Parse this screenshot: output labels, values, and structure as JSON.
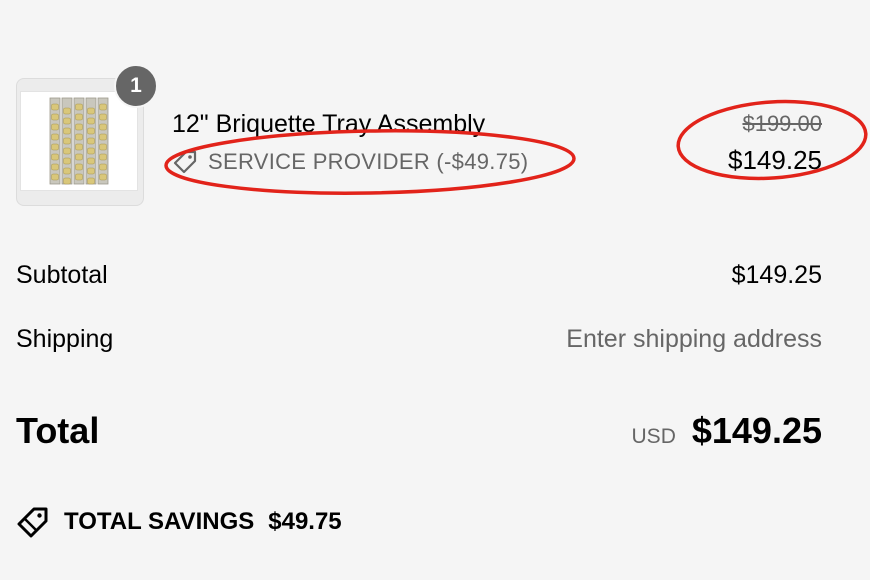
{
  "line_item": {
    "quantity": "1",
    "product_title": "12\" Briquette Tray Assembly",
    "discount_label": "SERVICE PROVIDER (-$49.75)",
    "original_price": "$199.00",
    "sale_price": "$149.25",
    "image_icon": "briquette-tray-product-image"
  },
  "summary": {
    "subtotal_label": "Subtotal",
    "subtotal_value": "$149.25",
    "shipping_label": "Shipping",
    "shipping_value": "Enter shipping address",
    "total_label": "Total",
    "total_currency": "USD",
    "total_value": "$149.25"
  },
  "savings": {
    "label": "TOTAL SAVINGS",
    "value": "$49.75",
    "icon": "tag-icon"
  },
  "colors": {
    "annotation": "#e2231a",
    "badge": "#666666",
    "muted_text": "#666666",
    "background": "#f5f5f5"
  }
}
